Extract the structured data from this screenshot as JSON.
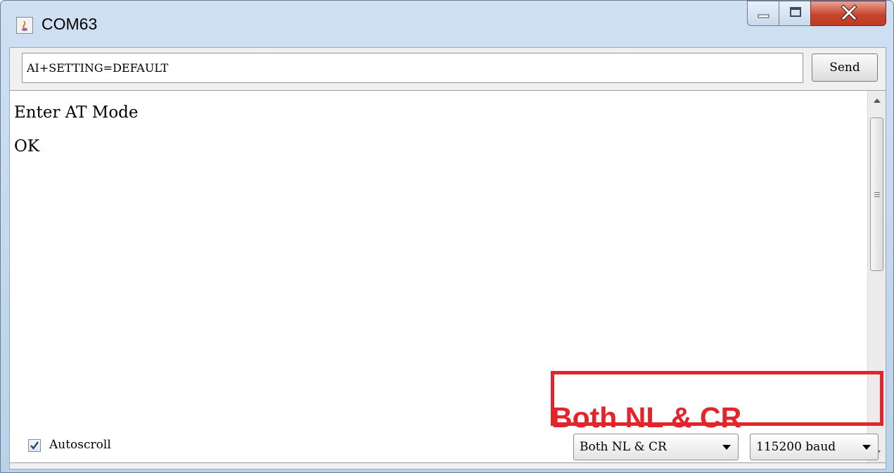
{
  "window": {
    "title": "COM63",
    "app_icon": "java-icon",
    "controls": [
      "minimize-icon",
      "maximize-icon",
      "close-icon"
    ]
  },
  "input": {
    "command_value": "AI+SETTING=DEFAULT",
    "send_label": "Send"
  },
  "output": {
    "lines": [
      "Enter AT Mode",
      "OK"
    ]
  },
  "annotation": {
    "text": "Both NL & CR",
    "color": "#e3242b"
  },
  "bottom_bar": {
    "autoscroll_label": "Autoscroll",
    "autoscroll_checked": true,
    "line_ending": "Both NL & CR",
    "baud_rate": "115200 baud"
  },
  "colors": {
    "highlight": "#e3242b",
    "close_button": "#c7452d"
  }
}
